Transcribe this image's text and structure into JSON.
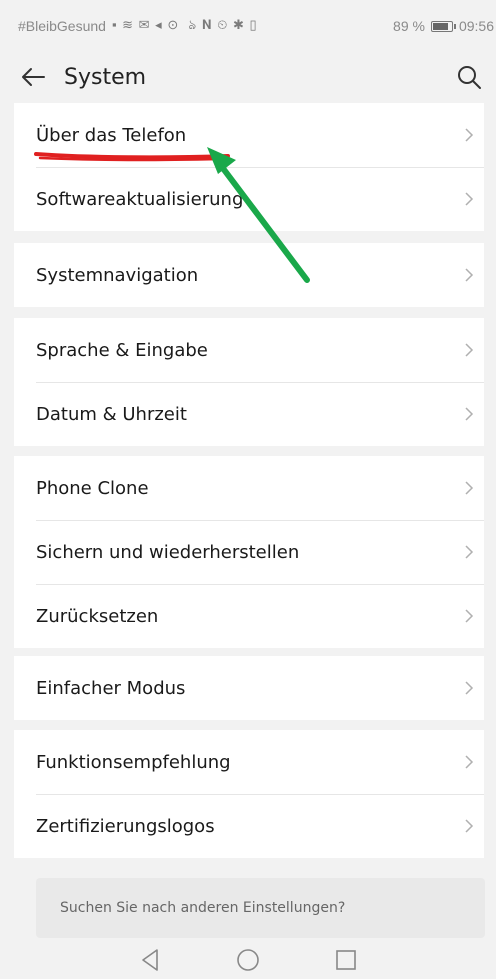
{
  "status": {
    "left_text": "#BleibGesund",
    "battery": "89 %",
    "time": "09:56"
  },
  "header": {
    "title": "System"
  },
  "groups": [
    {
      "items": [
        {
          "label": "Über das Telefon"
        },
        {
          "label": "Softwareaktualisierung"
        }
      ]
    },
    {
      "items": [
        {
          "label": "Systemnavigation"
        }
      ]
    },
    {
      "items": [
        {
          "label": "Sprache & Eingabe"
        },
        {
          "label": "Datum & Uhrzeit"
        }
      ]
    },
    {
      "items": [
        {
          "label": "Phone Clone"
        },
        {
          "label": "Sichern und wiederherstellen"
        },
        {
          "label": "Zurücksetzen"
        }
      ]
    },
    {
      "items": [
        {
          "label": "Einfacher Modus"
        }
      ]
    },
    {
      "items": [
        {
          "label": "Funktionsempfehlung"
        },
        {
          "label": "Zertifizierungslogos"
        }
      ]
    }
  ],
  "search_suggestion": "Suchen Sie nach anderen Einstellungen?",
  "annotation_colors": {
    "underline": "#e02020",
    "arrow": "#1aa84a"
  }
}
